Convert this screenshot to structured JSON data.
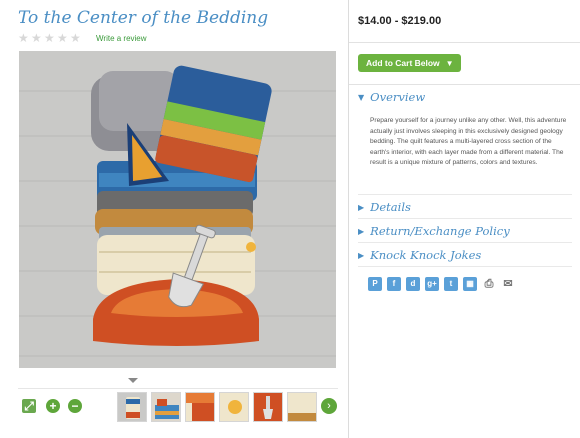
{
  "product": {
    "title": "To the Center of the Bedding",
    "review_link": "Write a review",
    "price_range": "$14.00 - $219.00",
    "add_to_cart": "Add to Cart Below"
  },
  "rating": {
    "stars": 0,
    "max": 5
  },
  "sections": {
    "overview": {
      "title": "Overview",
      "expanded": true,
      "text": "Prepare yourself for a journey unlike any other. Well, this adventure actually just involves sleeping in this exclusively designed geology bedding. The quilt features a multi-layered cross section of the earth's interior, with each layer made from a different material. The result is a unique mixture of patterns, colors and textures."
    },
    "details": {
      "title": "Details"
    },
    "policy": {
      "title": "Return/Exchange Policy"
    },
    "jokes": {
      "title": "Knock Knock Jokes"
    }
  },
  "share_icons": [
    "pinterest-icon",
    "facebook-icon",
    "delicious-icon",
    "google-plus-icon",
    "twitter-icon",
    "share-grid-icon",
    "print-icon",
    "email-icon"
  ],
  "thumbnails": [
    "thumbnail-bed-top",
    "thumbnail-bed-side",
    "thumbnail-bed-detail-orange",
    "thumbnail-bed-detail-cream",
    "thumbnail-shovel",
    "thumbnail-bed-corner"
  ],
  "colors": {
    "accent_blue": "#4a8ec4",
    "cart_green": "#6cb33f",
    "icon_blue": "#5aa0d8"
  }
}
